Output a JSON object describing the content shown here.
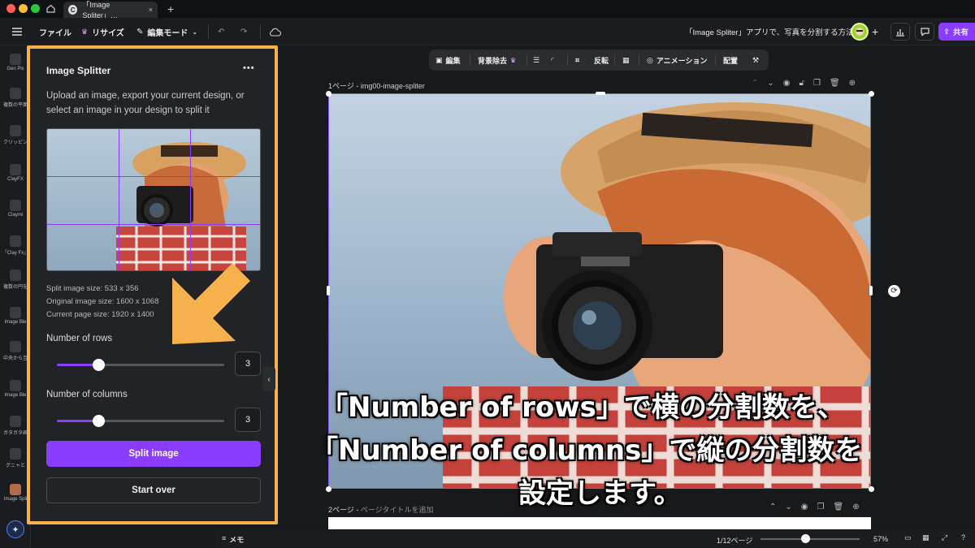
{
  "window": {
    "tab_title": "「Image Spliter」…",
    "tab_icon": "C",
    "new_tab": "+"
  },
  "toolbar": {
    "file": "ファイル",
    "resize": "リサイズ",
    "edit_mode": "編集モード",
    "doc_title": "「Image Spliter」アプリで、写真を分割する方法",
    "share": "共有"
  },
  "rail": {
    "items": [
      "Gen Pix",
      "複数の平面",
      "クリッピン",
      "ClayFX",
      "Claymi",
      "「Clay Fx」",
      "複数の円を",
      "Image Ble",
      "中央から互",
      "Image Ble",
      "ガタガタ画",
      "グニャと",
      "Image Spli"
    ]
  },
  "panel": {
    "title": "Image Splitter",
    "more": "•••",
    "description": "Upload an image, export your current design, or select an image in your design to split it",
    "split_size": "Split image size: 533 x 356",
    "original_size": "Original image size: 1600 x 1068",
    "page_size": "Current page size: 1920 x 1400",
    "rows_label": "Number of rows",
    "rows_value": "3",
    "rows_fraction": 0.25,
    "cols_label": "Number of columns",
    "cols_value": "3",
    "cols_fraction": 0.25,
    "split_button": "Split image",
    "start_over_button": "Start over"
  },
  "float_toolbar": {
    "edit": "編集",
    "bg_remove": "背景除去",
    "flip": "反転",
    "animation": "アニメーション",
    "arrange": "配置"
  },
  "pages": {
    "page1_label": "1ページ - img00-image-spliter",
    "page2_label": "2ページ - ",
    "page2_placeholder": "ページタイトルを追加"
  },
  "bottom": {
    "notes": "メモ",
    "page_count": "1/12ページ",
    "zoom": "57%",
    "zoom_fraction": 0.45
  },
  "caption": {
    "line1": "「Number of rows」で横の分割数を、",
    "line2": "「Number of columns」で縦の分割数を",
    "line3": "設定します。"
  },
  "colors": {
    "accent": "#8b3dff",
    "highlight": "#f6b04c",
    "share": "#8b3dff"
  }
}
